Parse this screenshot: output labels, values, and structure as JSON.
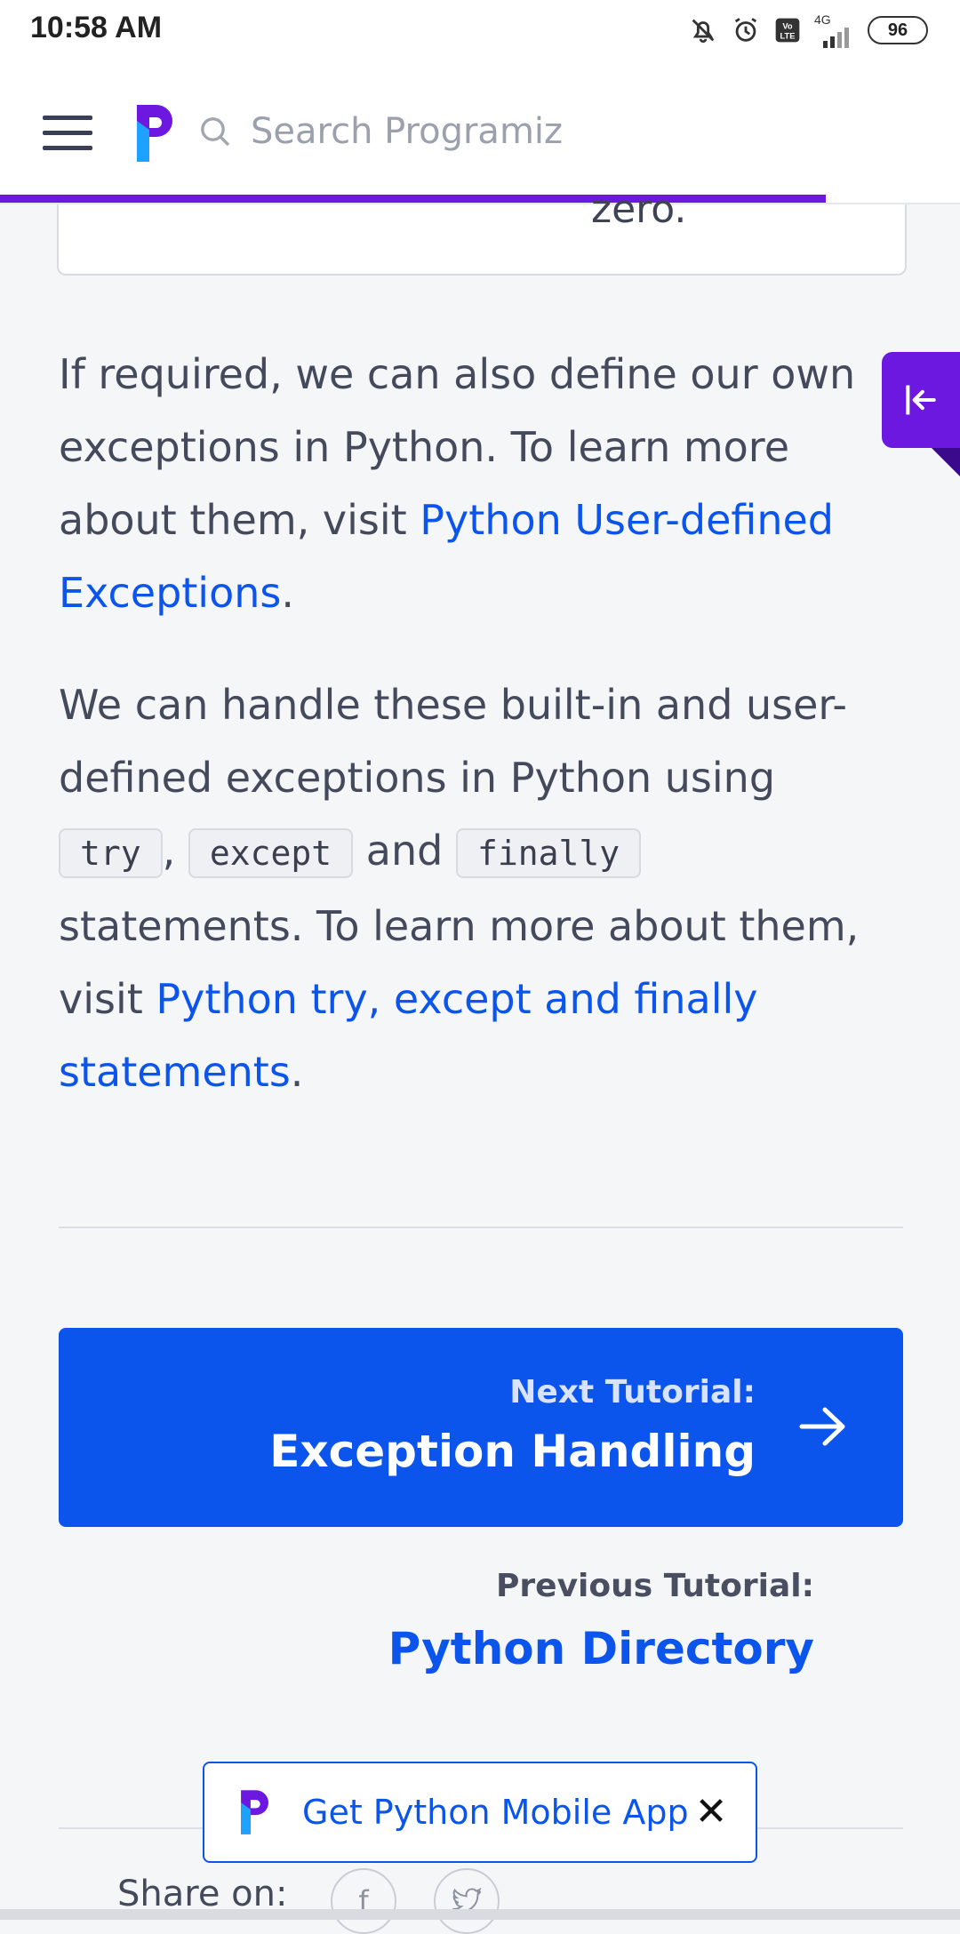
{
  "status_bar": {
    "time": "10:58 AM",
    "network": "4G",
    "battery": "96",
    "icons": [
      "bell-muted-icon",
      "alarm-icon",
      "volte-icon",
      "signal-icon"
    ]
  },
  "header": {
    "search_placeholder": "Search Programiz",
    "progress_percent": 86
  },
  "content": {
    "card_tail": "zero.",
    "p1_text": "If required, we can also define our own exceptions in Python. To learn more about them, visit ",
    "p1_link": "Python User-defined Exceptions",
    "p1_end": ".",
    "p2_a": "We can handle these built-in and user-defined exceptions in Python using ",
    "code_try": "try",
    "sep_comma": ", ",
    "code_except": "except",
    "sep_and": " and ",
    "code_finally": "finally",
    "p2_b": " statements. To learn more about them, visit ",
    "p2_link": "Python try, except and finally statements",
    "p2_end": "."
  },
  "navigation": {
    "next_label": "Next Tutorial:",
    "next_title": "Exception Handling",
    "prev_label": "Previous Tutorial:",
    "prev_title": "Python Directory"
  },
  "share": {
    "label": "Share on:",
    "facebook_glyph": "f",
    "twitter_glyph": "t"
  },
  "app_banner": {
    "text": "Get Python Mobile App",
    "close_glyph": "✕"
  },
  "colors": {
    "brand_purple": "#6c18e1",
    "link_blue": "#0b55ec",
    "text": "#45495c"
  }
}
